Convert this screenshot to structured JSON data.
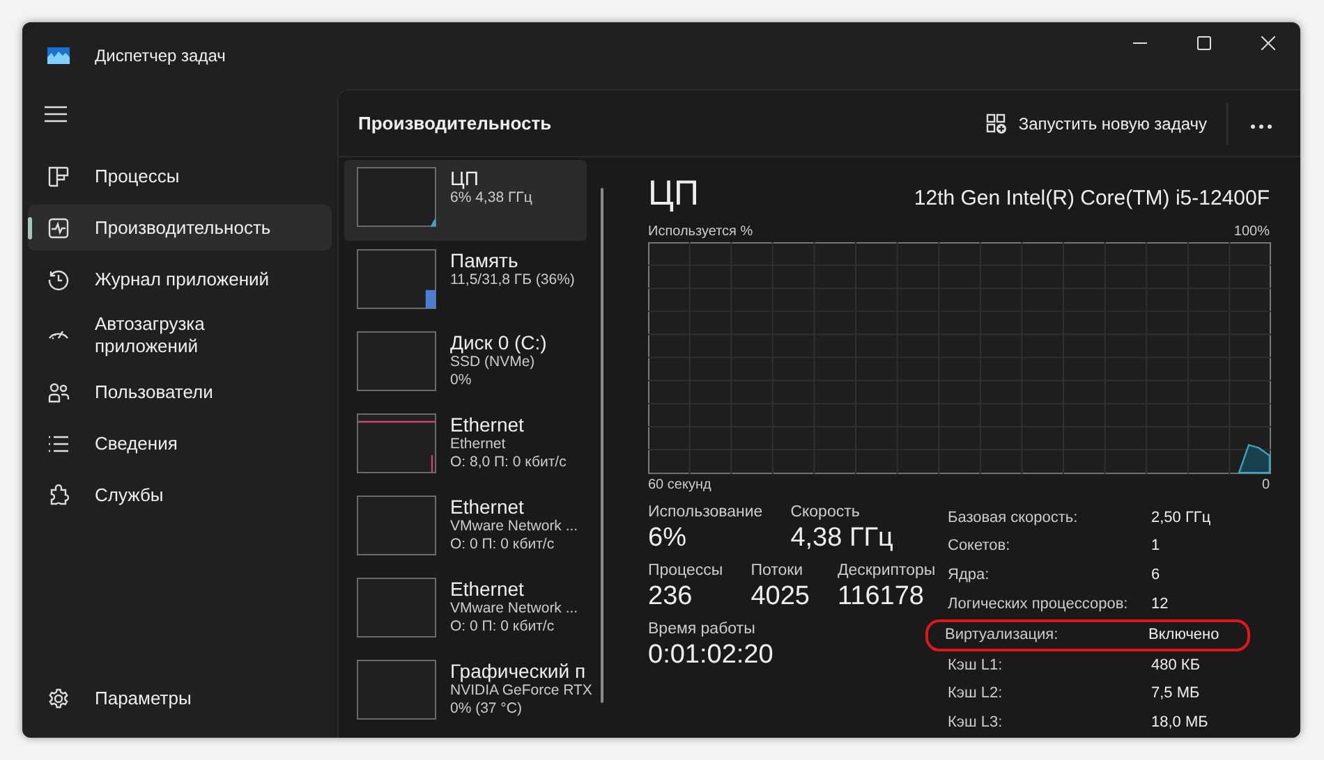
{
  "window": {
    "title": "Диспетчер задач"
  },
  "sidebar": {
    "items": [
      {
        "label": "Процессы",
        "selected": false
      },
      {
        "label": "Производительность",
        "selected": true
      },
      {
        "label": "Журнал приложений",
        "selected": false
      },
      {
        "label": "Автозагрузка приложений",
        "selected": false
      },
      {
        "label": "Пользователи",
        "selected": false
      },
      {
        "label": "Сведения",
        "selected": false
      },
      {
        "label": "Службы",
        "selected": false
      }
    ],
    "footer_item": {
      "label": "Параметры"
    }
  },
  "header": {
    "title": "Производительность",
    "run_task_button": "Запустить новую задачу"
  },
  "devices": [
    {
      "kind": "cpu",
      "name": "ЦП",
      "lines": [
        "6% 4,38 ГГц"
      ],
      "selected": true
    },
    {
      "kind": "memory",
      "name": "Память",
      "lines": [
        "11,5/31,8 ГБ (36%)"
      ],
      "selected": false
    },
    {
      "kind": "disk",
      "name": "Диск 0 (C:)",
      "lines": [
        "SSD (NVMe)",
        "0%"
      ],
      "selected": false
    },
    {
      "kind": "ethernet",
      "name": "Ethernet",
      "lines": [
        "Ethernet",
        "О: 8,0 П: 0 кбит/с"
      ],
      "selected": false
    },
    {
      "kind": "idle",
      "name": "Ethernet",
      "lines": [
        "VMware Network ...",
        "О: 0 П: 0 кбит/с"
      ],
      "selected": false
    },
    {
      "kind": "idle",
      "name": "Ethernet",
      "lines": [
        "VMware Network ...",
        "О: 0 П: 0 кбит/с"
      ],
      "selected": false
    },
    {
      "kind": "idle",
      "name": "Графический п",
      "lines": [
        "NVIDIA GeForce RTX",
        "0% (37 °C)"
      ],
      "selected": false
    }
  ],
  "detail": {
    "title": "ЦП",
    "model": "12th Gen Intel(R) Core(TM) i5-12400F",
    "graph": {
      "ylabel": "Используется %",
      "ymax": "100%",
      "xlabel": "60 секунд",
      "xmin": "0"
    },
    "stats": [
      [
        {
          "label": "Использование",
          "value": "6%"
        },
        {
          "label": "Скорость",
          "value": "4,38 ГГц"
        }
      ],
      [
        {
          "label": "Процессы",
          "value": "236"
        },
        {
          "label": "Потоки",
          "value": "4025"
        },
        {
          "label": "Дескрипторы",
          "value": "116178"
        }
      ],
      [
        {
          "label": "Время работы",
          "value": "0:01:02:20"
        }
      ]
    ],
    "specs": [
      {
        "label": "Базовая скорость:",
        "value": "2,50 ГГц",
        "highlighted": false
      },
      {
        "label": "Сокетов:",
        "value": "1",
        "highlighted": false
      },
      {
        "label": "Ядра:",
        "value": "6",
        "highlighted": false
      },
      {
        "label": "Логических процессоров:",
        "value": "12",
        "highlighted": false
      },
      {
        "label": "Виртуализация:",
        "value": "Включено",
        "highlighted": true
      },
      {
        "label": "Кэш L1:",
        "value": "480 КБ",
        "highlighted": false
      },
      {
        "label": "Кэш L2:",
        "value": "7,5 МБ",
        "highlighted": false
      },
      {
        "label": "Кэш L3:",
        "value": "18,0 МБ",
        "highlighted": false
      }
    ]
  }
}
